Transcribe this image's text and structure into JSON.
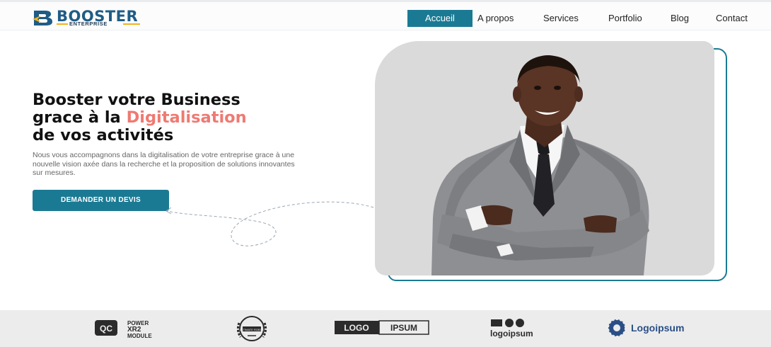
{
  "brand": {
    "name": "BOOSTER",
    "tagline": "ENTERPRISE"
  },
  "nav": [
    {
      "label": "Accueil",
      "active": true
    },
    {
      "label": "A propos",
      "active": false
    },
    {
      "label": "Services",
      "active": false
    },
    {
      "label": "Portfolio",
      "active": false
    },
    {
      "label": "Blog",
      "active": false
    },
    {
      "label": "Contact",
      "active": false
    }
  ],
  "hero": {
    "title_line1": "Booster votre Business",
    "title_line2_prefix": "grace à la ",
    "title_line2_highlight": "Digitalisation",
    "title_line3": "de vos activités",
    "description": "Nous vous accompagnons dans la digitalisation de votre entreprise grace à une nouvelle vision axée dans la recherche et la proposition de solutions innovantes sur mesures.",
    "cta_label": "DEMANDER UN DEVIS"
  },
  "partners": {
    "power": {
      "badge": "QC",
      "line1": "POWER",
      "line2": "XR2",
      "line3": "MODULE"
    },
    "award": {
      "text": "ULTIMATE ROBOT"
    },
    "logo_ipsum": {
      "left": "LOGO",
      "right": "IPSUM"
    },
    "logoipsum_mark": {
      "text": "logoipsum"
    },
    "logoipsum_badge": {
      "text": "Logoipsum"
    }
  },
  "colors": {
    "primary": "#1b7a93",
    "accent": "#ee7a72",
    "brand_blue": "#1f5c86",
    "brand_yellow": "#f1b21a"
  }
}
